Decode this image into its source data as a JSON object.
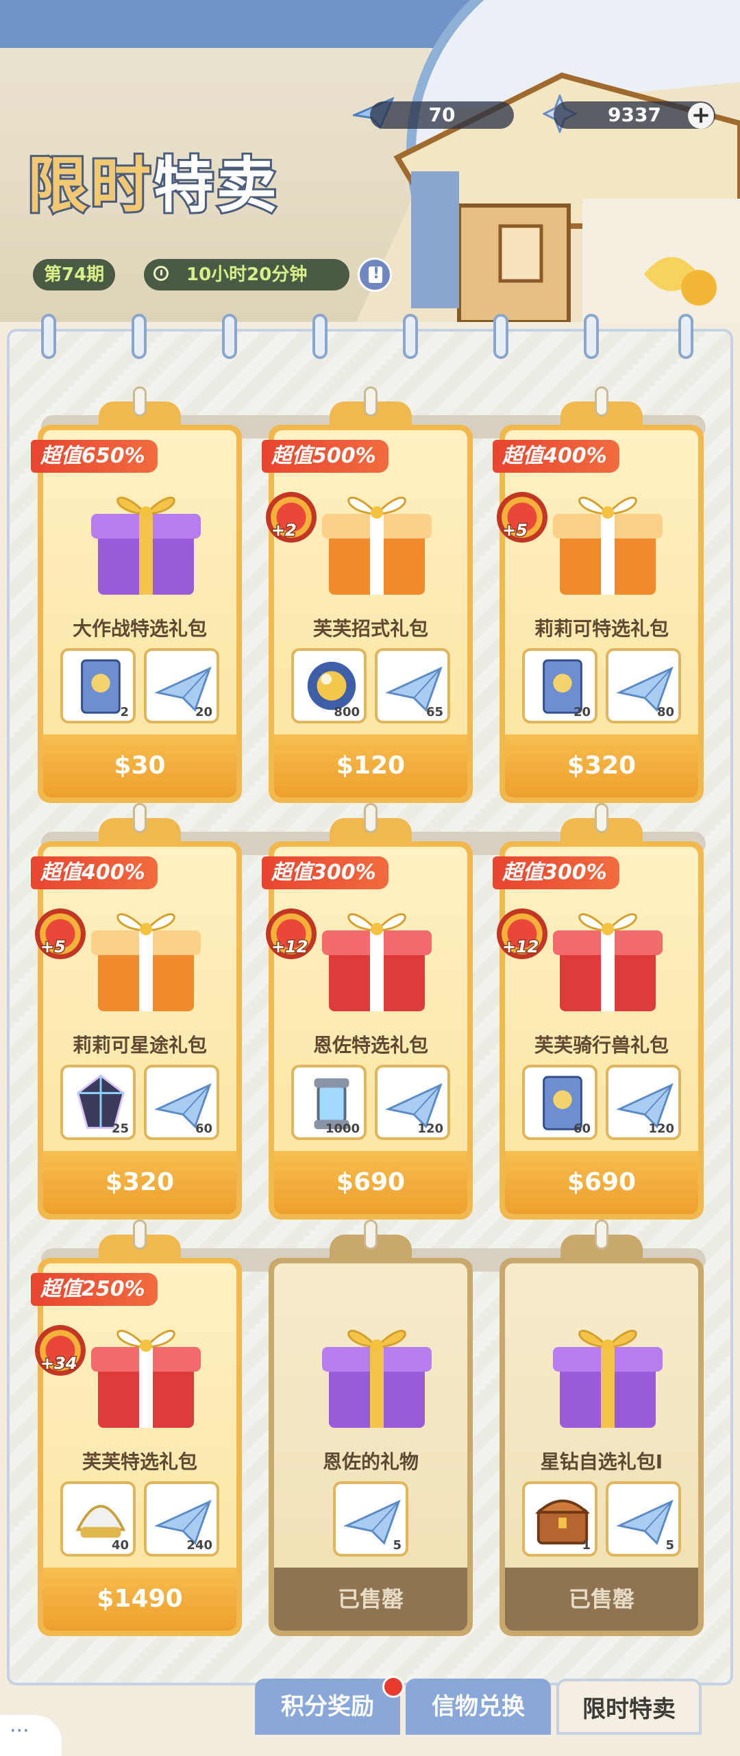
{
  "header": {
    "title_part1": "限时",
    "title_part2": "特卖",
    "period": "第74期",
    "timer": "10小时20分钟",
    "currency_plane": "70",
    "currency_gem": "9337",
    "plus": "+"
  },
  "cards": [
    {
      "value_tag": "超值650%",
      "name": "大作战特选礼包",
      "bonus": "",
      "items": [
        {
          "icon": "card-icon",
          "count": "2"
        },
        {
          "icon": "paper-plane-icon",
          "count": "20"
        }
      ],
      "price": "$30",
      "gift_color": "purple"
    },
    {
      "value_tag": "超值500%",
      "name": "芙芙招式礼包",
      "bonus": "+2",
      "items": [
        {
          "icon": "crystal-orb-icon",
          "count": "800"
        },
        {
          "icon": "paper-plane-icon",
          "count": "65"
        }
      ],
      "price": "$120",
      "gift_color": "orange"
    },
    {
      "value_tag": "超值400%",
      "name": "莉莉可特选礼包",
      "bonus": "+5",
      "items": [
        {
          "icon": "card-icon",
          "count": "20"
        },
        {
          "icon": "paper-plane-icon",
          "count": "80"
        }
      ],
      "price": "$320",
      "gift_color": "orange"
    },
    {
      "value_tag": "超值400%",
      "name": "莉莉可星途礼包",
      "bonus": "+5",
      "items": [
        {
          "icon": "prism-gem-icon",
          "count": "25"
        },
        {
          "icon": "paper-plane-icon",
          "count": "60"
        }
      ],
      "price": "$320",
      "gift_color": "orange"
    },
    {
      "value_tag": "超值300%",
      "name": "恩佐特选礼包",
      "bonus": "+12",
      "items": [
        {
          "icon": "energy-capsule-icon",
          "count": "1000"
        },
        {
          "icon": "paper-plane-icon",
          "count": "120"
        }
      ],
      "price": "$690",
      "gift_color": "red"
    },
    {
      "value_tag": "超值300%",
      "name": "芙芙骑行兽礼包",
      "bonus": "+12",
      "items": [
        {
          "icon": "card-icon",
          "count": "60"
        },
        {
          "icon": "paper-plane-icon",
          "count": "120"
        }
      ],
      "price": "$690",
      "gift_color": "red"
    },
    {
      "value_tag": "超值250%",
      "name": "芙芙特选礼包",
      "bonus": "+34",
      "items": [
        {
          "icon": "helmet-icon",
          "count": "40"
        },
        {
          "icon": "paper-plane-icon",
          "count": "240"
        }
      ],
      "price": "$1490",
      "gift_color": "red"
    },
    {
      "value_tag": "",
      "name": "恩佐的礼物",
      "bonus": "",
      "items": [
        {
          "icon": "paper-plane-icon",
          "count": "5"
        }
      ],
      "price": "已售罄",
      "gift_color": "purple",
      "sold": true
    },
    {
      "value_tag": "",
      "name": "星钻自选礼包I",
      "bonus": "",
      "items": [
        {
          "icon": "treasure-chest-icon",
          "count": "1"
        },
        {
          "icon": "paper-plane-icon",
          "count": "5"
        }
      ],
      "price": "已售罄",
      "gift_color": "purple",
      "sold": true
    }
  ],
  "tabs": {
    "points": "积分奖励",
    "exchange": "信物兑换",
    "flash": "限时特卖"
  },
  "colors": {
    "accent_orange": "#f1b84d",
    "tag_red": "#e8452f",
    "tab_blue": "#89a8d8"
  }
}
